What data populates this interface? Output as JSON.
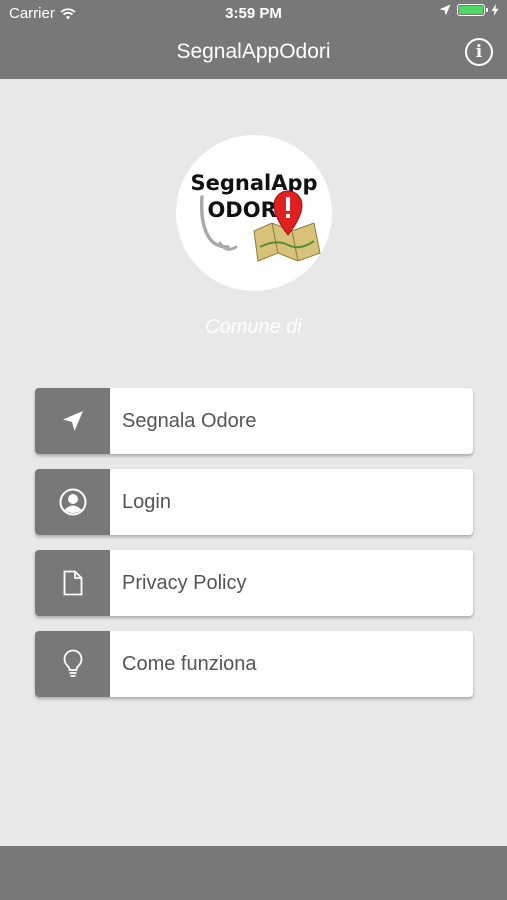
{
  "status_bar": {
    "carrier": "Carrier",
    "time": "3:59 PM",
    "icons": [
      "wifi-icon",
      "location-arrow-icon",
      "battery-icon",
      "charging-bolt-icon"
    ]
  },
  "nav": {
    "title": "SegnalAppOdori",
    "info_icon": "info-icon"
  },
  "logo": {
    "line1": "SegnalApp",
    "line2": "ODORI",
    "alt": "SegnalAppOdori logo"
  },
  "subtitle": "Comune di",
  "menu": [
    {
      "label": "Segnala Odore",
      "icon": "send-arrow-icon"
    },
    {
      "label": "Login",
      "icon": "user-icon"
    },
    {
      "label": "Privacy Policy",
      "icon": "document-icon"
    },
    {
      "label": "Come funziona",
      "icon": "lightbulb-icon"
    }
  ],
  "colors": {
    "bar": "#787878",
    "background": "#e8e8e8",
    "battery": "#4cd964",
    "pin": "#e02020"
  }
}
